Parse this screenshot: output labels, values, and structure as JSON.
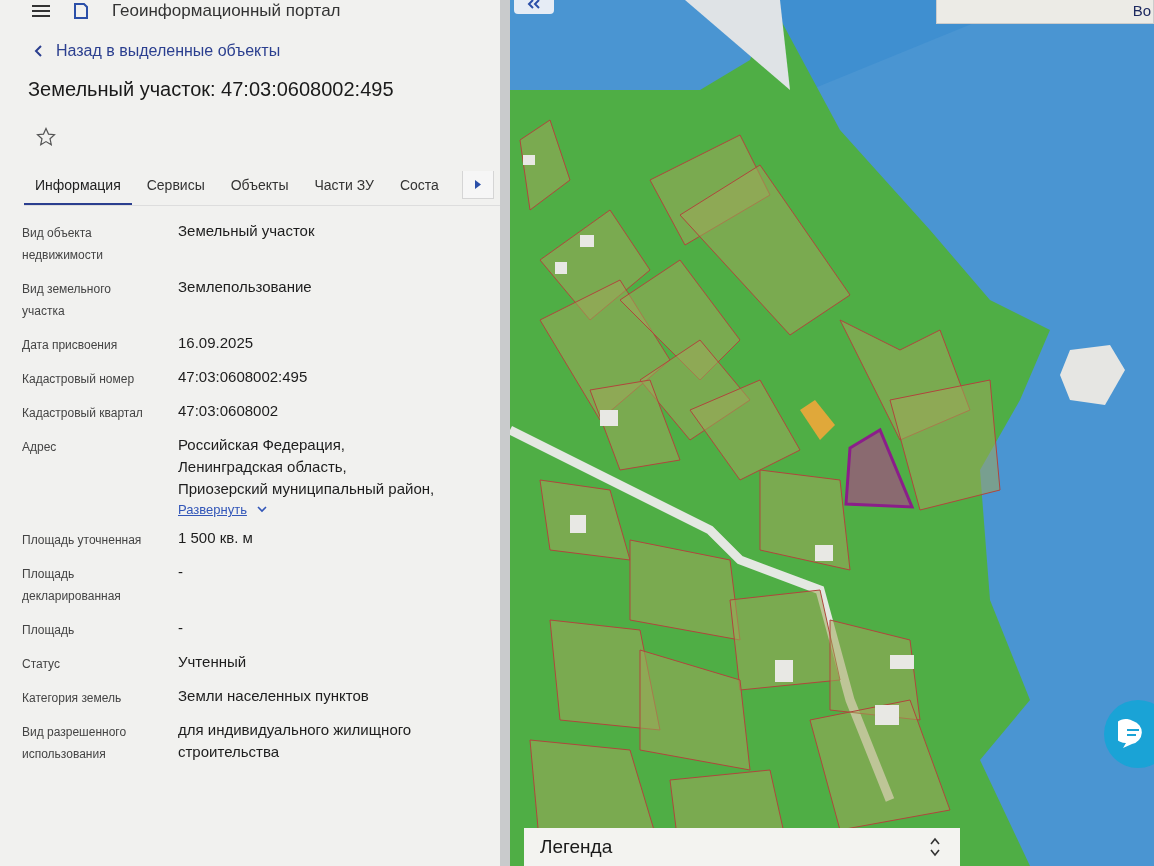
{
  "header": {
    "title": "Геоинформационный портал"
  },
  "back_link": "Назад в выделенные объекты",
  "title": "Земельный участок: 47:03:0608002:495",
  "favorite": {
    "on": false
  },
  "tabs": [
    {
      "label": "Информация",
      "selected": true
    },
    {
      "label": "Сервисы",
      "selected": false
    },
    {
      "label": "Объекты",
      "selected": false
    },
    {
      "label": "Части ЗУ",
      "selected": false
    },
    {
      "label": "Соста",
      "selected": false
    }
  ],
  "fields": [
    {
      "kind": "text",
      "label": "Вид объекта недвижимости",
      "value": "Земельный участок"
    },
    {
      "kind": "text",
      "label": "Вид земельного участка",
      "value": "Землепользование"
    },
    {
      "kind": "text",
      "label": "Дата присвоения",
      "value": "16.09.2025"
    },
    {
      "kind": "text",
      "label": "Кадастровый номер",
      "value": "47:03:0608002:495"
    },
    {
      "kind": "text",
      "label": "Кадастровый квартал",
      "value": "47:03:0608002"
    },
    {
      "kind": "address",
      "label": "Адрес",
      "lines": [
        "Российская Федерация,",
        "Ленинградская область,",
        "Приозерский муниципальный район,"
      ],
      "expand_link": "Развернуть"
    },
    {
      "kind": "text",
      "label": "Площадь уточненная",
      "value": "1 500 кв. м"
    },
    {
      "kind": "text",
      "label": "Площадь декларированная",
      "value": "-"
    },
    {
      "kind": "text",
      "label": "Площадь",
      "value": "-"
    },
    {
      "kind": "text",
      "label": "Статус",
      "value": "Учтенный"
    },
    {
      "kind": "text",
      "label": "Категория земель",
      "value": "Земли населенных пунктов"
    },
    {
      "kind": "text",
      "label": "Вид разрешенного использования",
      "value": "для индивидуального жилищного строительства"
    }
  ],
  "map": {
    "search_text": "Во",
    "legend": {
      "title": "Легенда"
    }
  }
}
